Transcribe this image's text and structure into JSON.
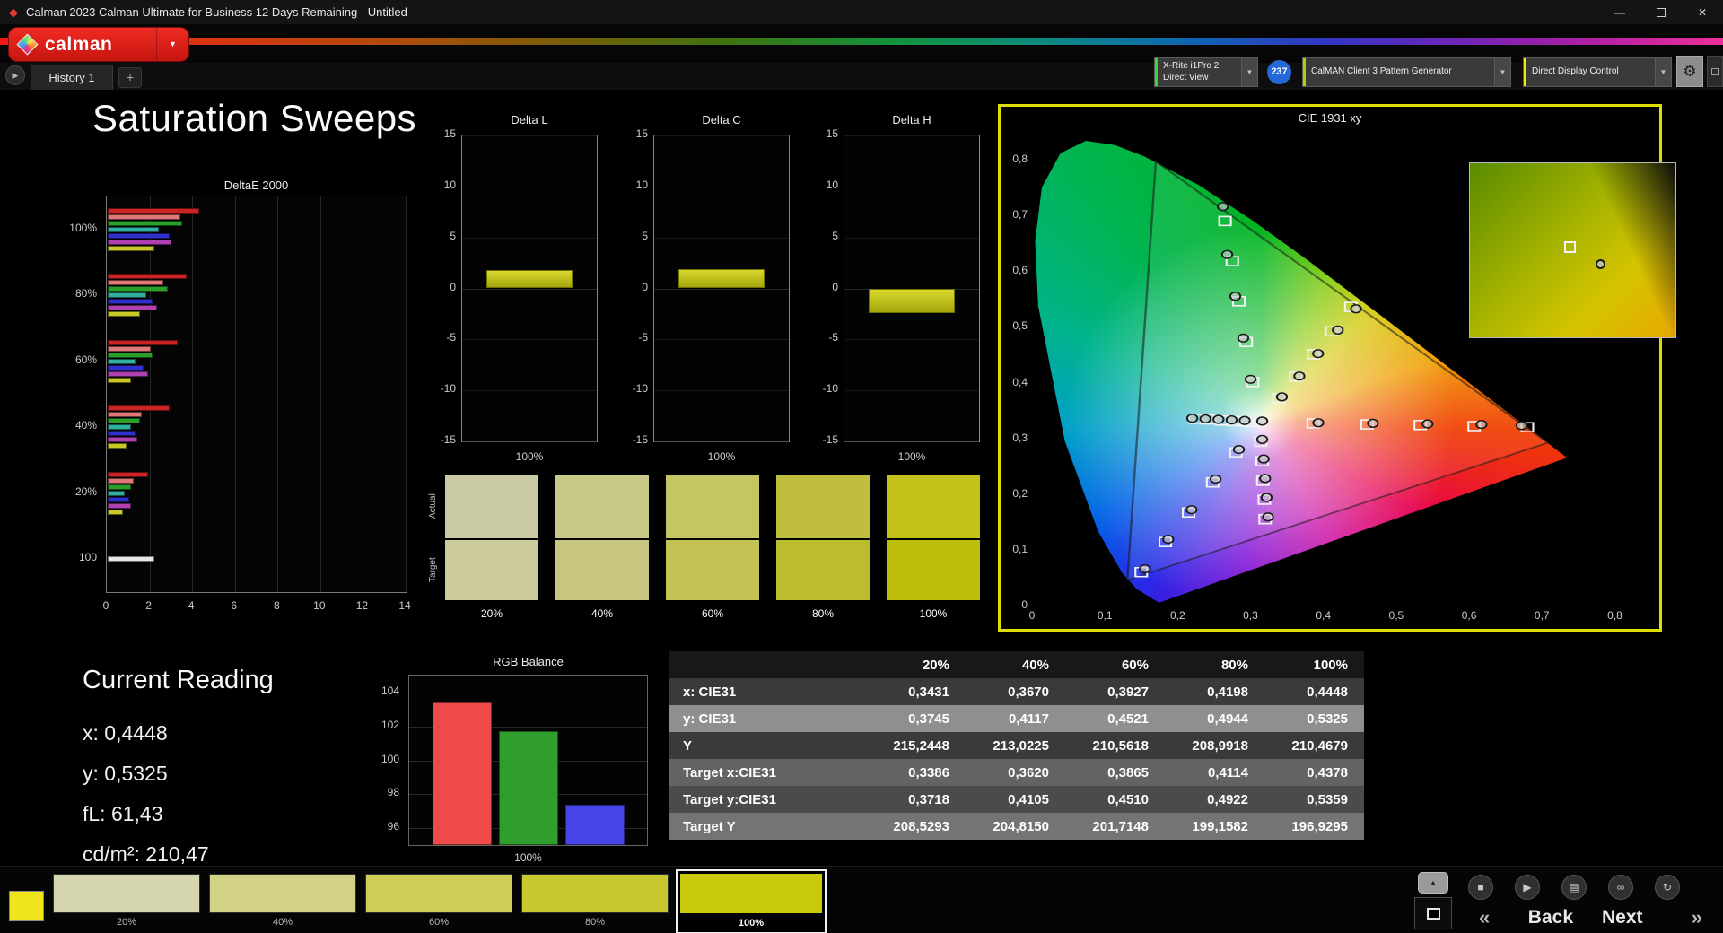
{
  "window": {
    "title": "Calman 2023 Calman Ultimate for Business 12 Days Remaining  - Untitled"
  },
  "icons": {
    "gem": "◆",
    "minimize": "—",
    "close": "✕",
    "dropdown": "▼",
    "tab_arrow": "▶",
    "gear": "⚙",
    "stop": "■",
    "play": "▶",
    "save": "▤",
    "link": "∞",
    "refresh": "↻",
    "eject": "▲",
    "back_chevron": "«",
    "next_chevron": "»"
  },
  "appbar": {
    "logo": "calman",
    "meter": {
      "line1": "X-Rite i1Pro 2",
      "line2": "Direct View",
      "accent": "#38d438"
    },
    "badge": {
      "text": "237",
      "color": "#2468d8"
    },
    "pattern_gen": {
      "label": "CalMAN Client 3 Pattern Generator",
      "accent": "#b8cc00"
    },
    "display_ctrl": {
      "label": "Direct Display Control",
      "accent": "#ecec00"
    }
  },
  "tabbar": {
    "tab": "History 1",
    "add": "+"
  },
  "page_title": "Saturation Sweeps",
  "delta_e": {
    "title": "DeltaE 2000",
    "x_max": 14,
    "x_ticks": [
      "0",
      "2",
      "4",
      "6",
      "8",
      "10",
      "12",
      "14"
    ],
    "groups": [
      {
        "label": "100%",
        "bars": [
          [
            "#cc2424",
            4.3
          ],
          [
            "#e07878",
            3.4
          ],
          [
            "#2aa02a",
            3.5
          ],
          [
            "#30b0a0",
            2.4
          ],
          [
            "#3030cc",
            2.9
          ],
          [
            "#b040b0",
            3.0
          ],
          [
            "#c8c828",
            2.2
          ]
        ]
      },
      {
        "label": "80%",
        "bars": [
          [
            "#cc2424",
            3.7
          ],
          [
            "#e07878",
            2.6
          ],
          [
            "#2aa02a",
            2.8
          ],
          [
            "#30b0a0",
            1.8
          ],
          [
            "#3030cc",
            2.1
          ],
          [
            "#b040b0",
            2.3
          ],
          [
            "#c8c828",
            1.5
          ]
        ]
      },
      {
        "label": "60%",
        "bars": [
          [
            "#cc2424",
            3.3
          ],
          [
            "#e07878",
            2.0
          ],
          [
            "#2aa02a",
            2.1
          ],
          [
            "#30b0a0",
            1.3
          ],
          [
            "#3030cc",
            1.7
          ],
          [
            "#b040b0",
            1.9
          ],
          [
            "#c8c828",
            1.1
          ]
        ]
      },
      {
        "label": "40%",
        "bars": [
          [
            "#cc2424",
            2.9
          ],
          [
            "#e07878",
            1.6
          ],
          [
            "#2aa02a",
            1.5
          ],
          [
            "#30b0a0",
            1.1
          ],
          [
            "#3030cc",
            1.3
          ],
          [
            "#b040b0",
            1.4
          ],
          [
            "#c8c828",
            0.9
          ]
        ]
      },
      {
        "label": "20%",
        "bars": [
          [
            "#cc2424",
            1.9
          ],
          [
            "#e07878",
            1.2
          ],
          [
            "#2aa02a",
            1.1
          ],
          [
            "#30b0a0",
            0.8
          ],
          [
            "#3030cc",
            1.0
          ],
          [
            "#b040b0",
            1.1
          ],
          [
            "#c8c828",
            0.7
          ]
        ]
      },
      {
        "label": "100",
        "bars": [
          [
            "#e8e8e8",
            2.2
          ]
        ]
      }
    ]
  },
  "delta_axis": {
    "min": -15,
    "max": 15,
    "ticks": [
      "15",
      "10",
      "5",
      "0",
      "-5",
      "-10",
      "-15"
    ]
  },
  "delta_charts": [
    {
      "title": "Delta L",
      "value": 1.8,
      "x_label": "100%"
    },
    {
      "title": "Delta C",
      "value": 1.9,
      "x_label": "100%"
    },
    {
      "title": "Delta H",
      "value": -2.4,
      "x_label": "100%"
    }
  ],
  "swatches": {
    "row_labels": [
      "Actual",
      "Target"
    ],
    "columns": [
      {
        "label": "20%",
        "actual": "#c9c9a2",
        "target": "#cbcb9e"
      },
      {
        "label": "40%",
        "actual": "#c9c987",
        "target": "#c6c680"
      },
      {
        "label": "60%",
        "actual": "#c5c562",
        "target": "#c2c255"
      },
      {
        "label": "80%",
        "actual": "#bfbf3d",
        "target": "#bcbc2f"
      },
      {
        "label": "100%",
        "actual": "#c2c219",
        "target": "#bdbd0b"
      }
    ]
  },
  "cie": {
    "title": "CIE 1931 xy",
    "x_ticks": [
      "0",
      "0,1",
      "0,2",
      "0,3",
      "0,4",
      "0,5",
      "0,6",
      "0,7",
      "0,8"
    ],
    "y_ticks": [
      "0,8",
      "0,7",
      "0,6",
      "0,5",
      "0,4",
      "0,3",
      "0,2",
      "0,1",
      "0"
    ],
    "gamut_triangle": [
      [
        0.708,
        0.292
      ],
      [
        0.17,
        0.797
      ],
      [
        0.131,
        0.046
      ]
    ],
    "targets": [
      [
        0.3127,
        0.329
      ],
      [
        0.386,
        0.327
      ],
      [
        0.46,
        0.325
      ],
      [
        0.533,
        0.324
      ],
      [
        0.607,
        0.322
      ],
      [
        0.68,
        0.32
      ],
      [
        0.303,
        0.401
      ],
      [
        0.294,
        0.473
      ],
      [
        0.284,
        0.546
      ],
      [
        0.275,
        0.618
      ],
      [
        0.265,
        0.69
      ],
      [
        0.28,
        0.275
      ],
      [
        0.248,
        0.221
      ],
      [
        0.215,
        0.167
      ],
      [
        0.183,
        0.114
      ],
      [
        0.15,
        0.06
      ],
      [
        0.295,
        0.33
      ],
      [
        0.277,
        0.331
      ],
      [
        0.26,
        0.332
      ],
      [
        0.242,
        0.334
      ],
      [
        0.224,
        0.335
      ],
      [
        0.314,
        0.294
      ],
      [
        0.316,
        0.259
      ],
      [
        0.317,
        0.224
      ],
      [
        0.319,
        0.19
      ],
      [
        0.32,
        0.155
      ],
      [
        0.3386,
        0.3718
      ],
      [
        0.362,
        0.4105
      ],
      [
        0.3865,
        0.451
      ],
      [
        0.4114,
        0.4922
      ],
      [
        0.4378,
        0.5359
      ]
    ],
    "measured": [
      [
        0.316,
        0.331
      ],
      [
        0.393,
        0.328
      ],
      [
        0.468,
        0.327
      ],
      [
        0.543,
        0.326
      ],
      [
        0.617,
        0.325
      ],
      [
        0.672,
        0.323
      ],
      [
        0.3,
        0.406
      ],
      [
        0.29,
        0.48
      ],
      [
        0.279,
        0.555
      ],
      [
        0.268,
        0.63
      ],
      [
        0.262,
        0.716
      ],
      [
        0.284,
        0.28
      ],
      [
        0.252,
        0.227
      ],
      [
        0.219,
        0.172
      ],
      [
        0.187,
        0.119
      ],
      [
        0.155,
        0.066
      ],
      [
        0.292,
        0.332
      ],
      [
        0.274,
        0.333
      ],
      [
        0.256,
        0.334
      ],
      [
        0.238,
        0.335
      ],
      [
        0.22,
        0.336
      ],
      [
        0.316,
        0.298
      ],
      [
        0.318,
        0.263
      ],
      [
        0.32,
        0.228
      ],
      [
        0.322,
        0.194
      ],
      [
        0.324,
        0.159
      ],
      [
        0.3431,
        0.3745
      ],
      [
        0.367,
        0.4117
      ],
      [
        0.3927,
        0.4521
      ],
      [
        0.4198,
        0.4944
      ],
      [
        0.4448,
        0.5325
      ]
    ]
  },
  "current_reading": {
    "title": "Current Reading",
    "lines": [
      "x: 0,4448",
      "y: 0,5325",
      "fL: 61,43",
      "cd/m²: 210,47"
    ]
  },
  "rgb_balance": {
    "title": "RGB Balance",
    "min": 95,
    "max": 105,
    "y_ticks": [
      "104",
      "102",
      "100",
      "98",
      "96"
    ],
    "bars": [
      {
        "c": "#ef4a4a",
        "v": 103.4
      },
      {
        "c": "#2f9e2f",
        "v": 101.7
      },
      {
        "c": "#4646e8",
        "v": 97.4
      }
    ],
    "x_label": "100%"
  },
  "table": {
    "headers": [
      "",
      "20%",
      "40%",
      "60%",
      "80%",
      "100%"
    ],
    "rows": [
      {
        "label": "x: CIE31",
        "style": "dark",
        "values": [
          "0,3431",
          "0,3670",
          "0,3927",
          "0,4198",
          "0,4448"
        ]
      },
      {
        "label": "y: CIE31",
        "style": "highlight",
        "values": [
          "0,3745",
          "0,4117",
          "0,4521",
          "0,4944",
          "0,5325"
        ]
      },
      {
        "label": "Y",
        "style": "dark",
        "values": [
          "215,2448",
          "213,0225",
          "210,5618",
          "208,9918",
          "210,4679"
        ]
      },
      {
        "label": "Target x:CIE31",
        "style": "mid",
        "values": [
          "0,3386",
          "0,3620",
          "0,3865",
          "0,4114",
          "0,4378"
        ]
      },
      {
        "label": "Target y:CIE31",
        "style": "mid2",
        "values": [
          "0,3718",
          "0,4105",
          "0,4510",
          "0,4922",
          "0,5359"
        ]
      },
      {
        "label": "Target Y",
        "style": "light",
        "values": [
          "208,5293",
          "204,8150",
          "201,7148",
          "199,1582",
          "196,9295"
        ]
      }
    ]
  },
  "bottombar": {
    "swatch_color": "#f0e41c",
    "patches": [
      {
        "label": "20%",
        "color": "#d6d6ae"
      },
      {
        "label": "40%",
        "color": "#d2d287"
      },
      {
        "label": "60%",
        "color": "#cdcd58"
      },
      {
        "label": "80%",
        "color": "#c7c72e"
      },
      {
        "label": "100%",
        "color": "#c9c90e",
        "selected": true
      }
    ],
    "back": "Back",
    "next": "Next"
  }
}
